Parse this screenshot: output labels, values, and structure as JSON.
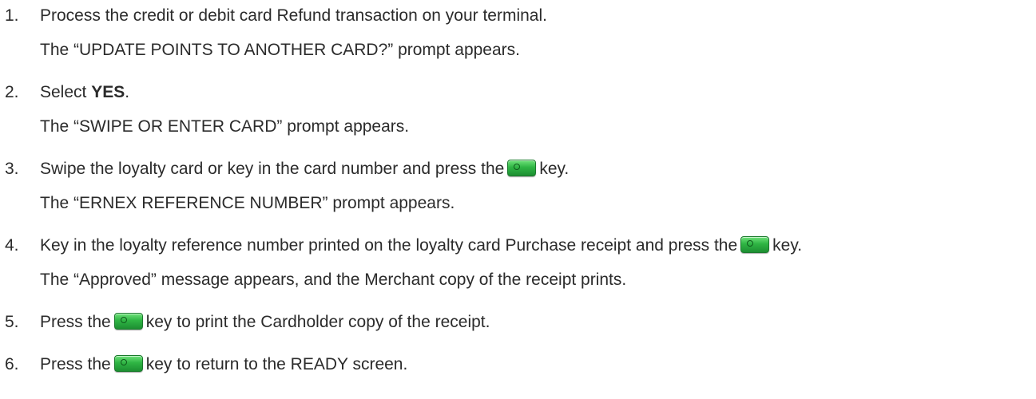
{
  "steps": [
    {
      "number": "1.",
      "text": "Process the credit or debit card Refund transaction on your terminal.",
      "result": "The “UPDATE POINTS TO ANOTHER CARD?” prompt appears."
    },
    {
      "number": "2.",
      "text_before": "Select ",
      "text_bold": "YES",
      "text_after": ".",
      "result": "The “SWIPE OR ENTER CARD” prompt appears."
    },
    {
      "number": "3.",
      "text_before": "Swipe the loyalty card or key in the card number and press the",
      "text_after": "key.",
      "result": "The “ERNEX REFERENCE NUMBER” prompt appears."
    },
    {
      "number": "4.",
      "text_before": "Key in the loyalty reference number printed on the loyalty card Purchase receipt and press the",
      "text_after": "key.",
      "result": "The “Approved” message appears, and the Merchant copy of the receipt prints."
    },
    {
      "number": "5.",
      "text_before": "Press the",
      "text_after": "key to print the Cardholder copy of the receipt."
    },
    {
      "number": "6.",
      "text_before": "Press the",
      "text_after": "key to return to the READY screen."
    }
  ],
  "icons": {
    "ok_key": "green-ok-key-icon"
  }
}
